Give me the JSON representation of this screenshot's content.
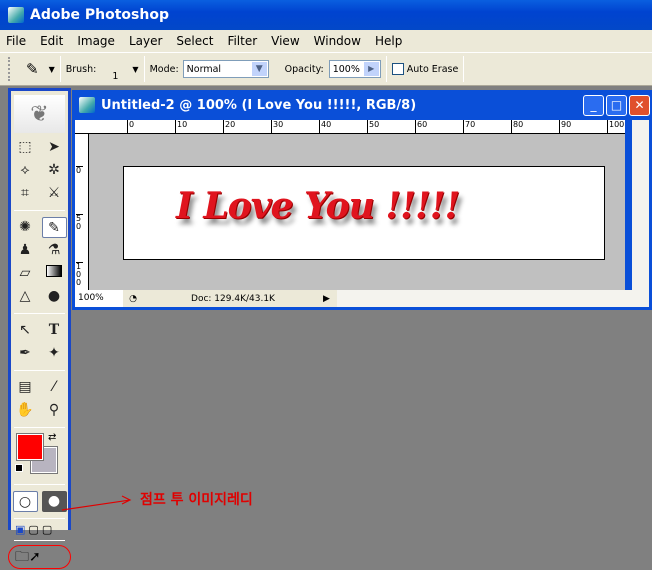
{
  "app": {
    "title": "Adobe Photoshop"
  },
  "menu": [
    "File",
    "Edit",
    "Image",
    "Layer",
    "Select",
    "Filter",
    "View",
    "Window",
    "Help"
  ],
  "options": {
    "brush_label": "Brush:",
    "brush_size": "1",
    "mode_label": "Mode:",
    "mode_value": "Normal",
    "opacity_label": "Opacity:",
    "opacity_value": "100%",
    "auto_erase": "Auto Erase",
    "auto_erase_checked": false
  },
  "document": {
    "title": "Untitled-2 @ 100% (I Love You !!!!!, RGB/8)",
    "text": "I Love You !!!!!",
    "zoom": "100%",
    "doc_info": "Doc: 129.4K/43.1K",
    "ruler_h": [
      "0",
      "10",
      "20",
      "30",
      "40",
      "50",
      "60",
      "70",
      "80",
      "90",
      "100"
    ],
    "ruler_v": [
      "0",
      "50",
      "100"
    ]
  },
  "colors": {
    "foreground": "#ff0000",
    "background": "#b8b4c0"
  },
  "annotation": "점프 투 이미지레디"
}
